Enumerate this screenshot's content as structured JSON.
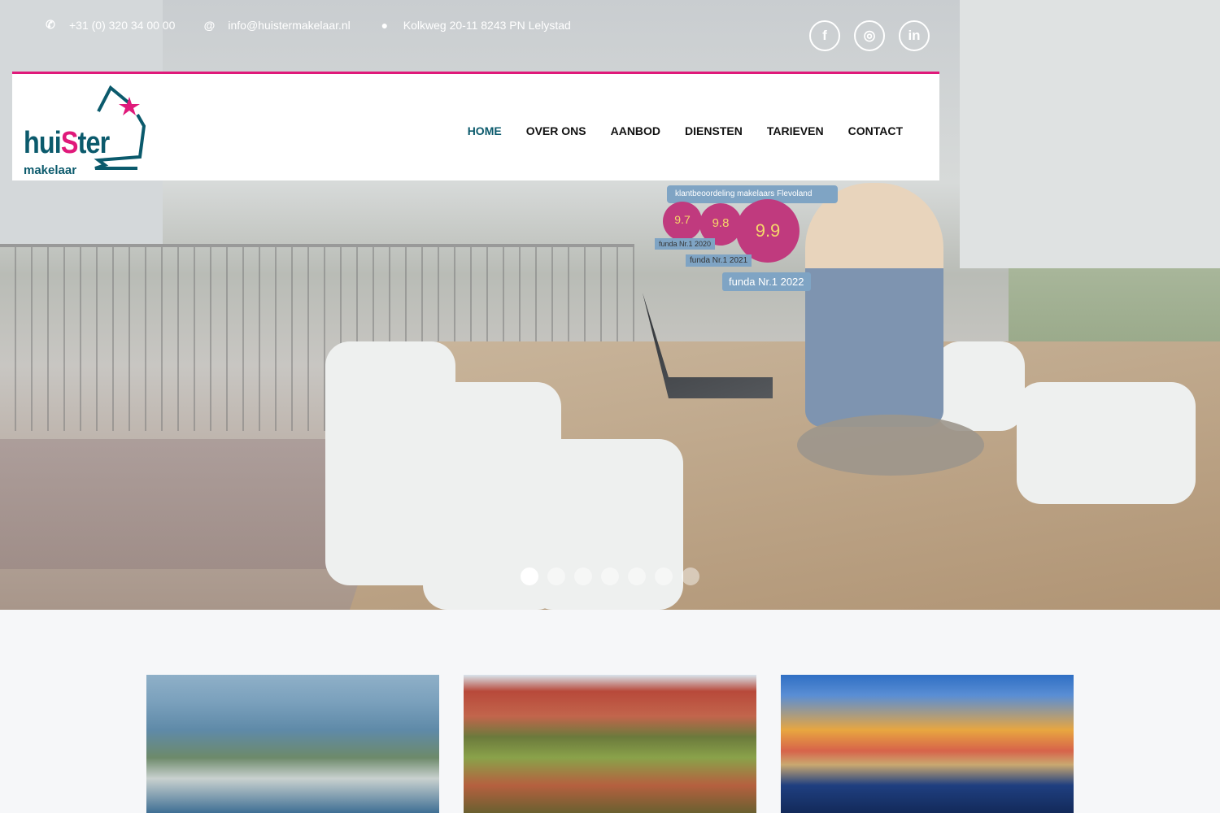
{
  "topbar": {
    "phone": "+31 (0) 320 34 00 00",
    "email": "info@huistermakelaar.nl",
    "address": "Kolkweg 20-11 8243 PN Lelystad"
  },
  "social": [
    {
      "icon": "facebook-icon",
      "glyph": "f"
    },
    {
      "icon": "instagram-icon",
      "glyph": "◎"
    },
    {
      "icon": "linkedin-icon",
      "glyph": "in"
    }
  ],
  "logo": {
    "text_a": "hui",
    "text_b": "S",
    "text_c": "ter",
    "sub": "makelaar"
  },
  "nav": [
    {
      "label": "HOME",
      "active": true
    },
    {
      "label": "OVER ONS"
    },
    {
      "label": "AANBOD"
    },
    {
      "label": "DIENSTEN"
    },
    {
      "label": "TARIEVEN"
    },
    {
      "label": "CONTACT"
    }
  ],
  "hero": {
    "badge_text": "klantbeoordeling makelaars  Flevoland",
    "ratings": [
      "9.7",
      "9.8",
      "9.9"
    ],
    "funda": [
      "funda Nr.1 2020",
      "funda Nr.1 2021",
      "funda Nr.1 2022"
    ],
    "slides": 7,
    "active_slide": 1
  },
  "colors": {
    "brand": "#0b5a6c",
    "accent": "#e0197a"
  }
}
